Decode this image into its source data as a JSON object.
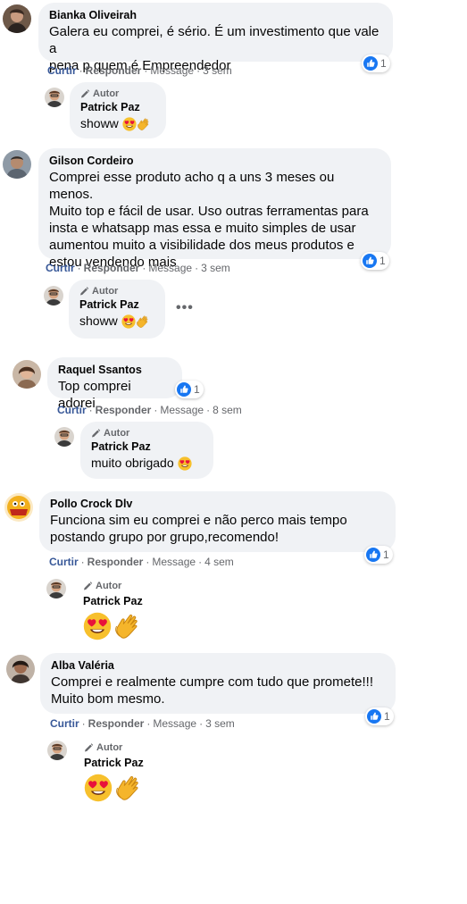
{
  "actions": {
    "like": "Curtir",
    "reply": "Responder",
    "message": "Message"
  },
  "author_badge": "Autor",
  "colors": {
    "link": "#385898",
    "meta": "#65676b",
    "bubble": "#f0f2f5",
    "like": "#1877f2"
  },
  "comments": [
    {
      "name": "Bianka Oliveirah",
      "lines": [
        "Galera eu comprei, é sério. É um investimento que vale a",
        "pena p quem é Empreendedor"
      ],
      "time": "3 sem",
      "reactions": "1",
      "reply": {
        "name": "Patrick Paz",
        "text": "showw",
        "emoji": [
          "heart-eyes-icon",
          "clapping-hands-icon"
        ]
      }
    },
    {
      "name": "Gilson Cordeiro",
      "lines": [
        "Comprei esse produto acho q a uns 3 meses ou menos.",
        "Muito top e fácil de usar. Uso outras ferramentas para",
        "insta e whatsapp mas essa e muito simples de usar",
        "aumentou muito a visibilidade dos meus produtos e",
        "estou vendendo mais"
      ],
      "time": "3 sem",
      "reactions": "1",
      "reply": {
        "name": "Patrick Paz",
        "text": "showw",
        "emoji": [
          "heart-eyes-icon",
          "clapping-hands-icon"
        ]
      }
    },
    {
      "name": "Raquel Ssantos",
      "lines": [
        "Top comprei adorei"
      ],
      "time": "8 sem",
      "reactions": "1",
      "reply": {
        "name": "Patrick Paz",
        "text": "muito obrigado",
        "emoji": [
          "heart-eyes-icon"
        ]
      }
    },
    {
      "name": "Pollo Crock Dlv",
      "lines": [
        "Funciona sim eu comprei e não perco mais tempo",
        "postando grupo por grupo,recomendo!"
      ],
      "time": "4 sem",
      "reactions": "1",
      "reply": {
        "name": "Patrick Paz",
        "text": "",
        "emoji": [
          "heart-eyes-icon",
          "clapping-hands-icon"
        ]
      }
    },
    {
      "name": "Alba Valéria",
      "lines": [
        "Comprei e realmente cumpre com tudo que promete!!!",
        "Muito bom mesmo."
      ],
      "time": "3 sem",
      "reactions": "1",
      "reply": {
        "name": "Patrick Paz",
        "text": "",
        "emoji": [
          "heart-eyes-icon",
          "clapping-hands-icon"
        ]
      }
    }
  ]
}
